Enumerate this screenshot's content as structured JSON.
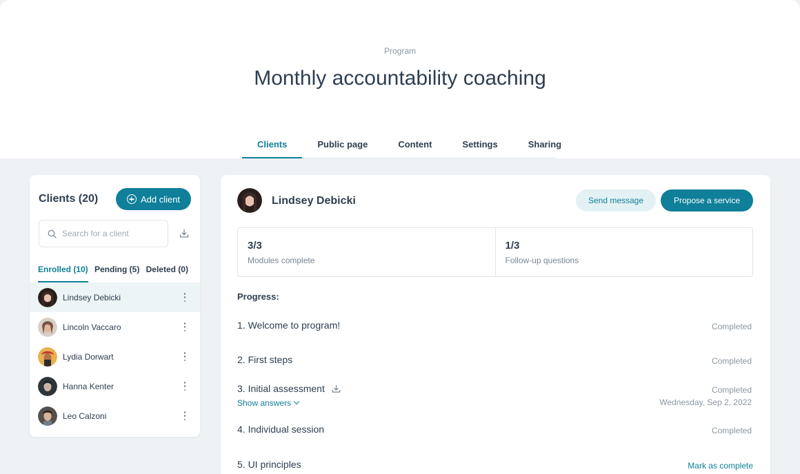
{
  "header": {
    "eyebrow": "Program",
    "title": "Monthly accountability coaching"
  },
  "tabs": [
    {
      "label": "Clients",
      "active": true
    },
    {
      "label": "Public page",
      "active": false
    },
    {
      "label": "Content",
      "active": false
    },
    {
      "label": "Settings",
      "active": false
    },
    {
      "label": "Sharing",
      "active": false
    }
  ],
  "clients_panel": {
    "title": "Clients (20)",
    "add_button": "Add client",
    "search_placeholder": "Search for a client",
    "sub_tabs": [
      {
        "label": "Enrolled (10)",
        "active": true
      },
      {
        "label": "Pending (5)",
        "active": false
      },
      {
        "label": "Deleted (0)",
        "active": false
      }
    ],
    "clients": [
      {
        "name": "Lindsey Debicki",
        "selected": true,
        "avatar_color": "#3a2a26"
      },
      {
        "name": "Lincoln Vaccaro",
        "selected": false,
        "avatar_color": "#8a6a5c"
      },
      {
        "name": "Lydia Dorwart",
        "selected": false,
        "avatar_color": "#e3a64a"
      },
      {
        "name": "Hanna Kenter",
        "selected": false,
        "avatar_color": "#3d4247"
      },
      {
        "name": "Leo Calzoni",
        "selected": false,
        "avatar_color": "#4a4440"
      }
    ]
  },
  "detail": {
    "client_name": "Lindsey Debicki",
    "send_message": "Send message",
    "propose_service": "Propose a service",
    "stats": [
      {
        "value": "3/3",
        "label": "Modules complete"
      },
      {
        "value": "1/3",
        "label": "Follow-up questions"
      }
    ],
    "progress_title": "Progress:",
    "modules": [
      {
        "name": "1. Welcome to program!",
        "status": "Completed",
        "date": ""
      },
      {
        "name": "2. First steps",
        "status": "Completed",
        "date": ""
      },
      {
        "name": "3. Initial assessment",
        "status": "Completed",
        "date": "Wednesday, Sep 2, 2022",
        "show_answers": "Show answers"
      },
      {
        "name": "4. Individual session",
        "status": "Completed",
        "date": ""
      },
      {
        "name": "5. UI principles",
        "status": "Mark as complete",
        "date": ""
      }
    ]
  },
  "colors": {
    "accent": "#0f7f9a",
    "accent_light": "#e4f1f4",
    "background": "#eef2f5",
    "text": "#2d3e50",
    "muted": "#8a96a3"
  }
}
